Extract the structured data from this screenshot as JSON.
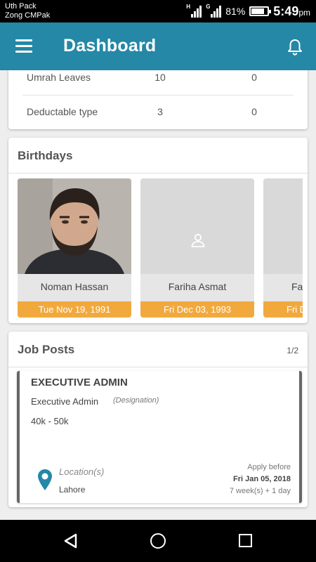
{
  "status_bar": {
    "carrier_line1": "Uth Pack",
    "carrier_line2": "Zong CMPak",
    "signal1_label": "H",
    "signal2_label": "G",
    "battery_percent": "81%",
    "battery_level": 0.81,
    "time": "5:49",
    "ampm": "pm"
  },
  "app_bar": {
    "title": "Dashboard",
    "menu_icon": "hamburger-menu-icon",
    "notification_icon": "bell-icon"
  },
  "leaves": {
    "rows": [
      {
        "type": "Umrah Leaves",
        "col2": "10",
        "col3": "0"
      },
      {
        "type": "Deductable type",
        "col2": "3",
        "col3": "0"
      }
    ]
  },
  "birthdays": {
    "title": "Birthdays",
    "items": [
      {
        "name": "Noman Hassan",
        "date": "Tue Nov 19, 1991",
        "has_photo": true
      },
      {
        "name": "Fariha Asmat",
        "date": "Fri Dec 03, 1993",
        "has_photo": false
      },
      {
        "name": "Fa",
        "date": "Fri D",
        "has_photo": false
      }
    ]
  },
  "job_posts": {
    "title": "Job Posts",
    "pager": "1/2",
    "job": {
      "title": "EXECUTIVE ADMIN",
      "designation": "Executive Admin",
      "designation_label": "(Designation)",
      "salary": "40k - 50k",
      "location_label": "Location(s)",
      "location": "Lahore",
      "apply_label": "Apply before",
      "apply_date": "Fri Jan 05, 2018",
      "apply_relative": "7 week(s) + 1 day"
    }
  },
  "colors": {
    "app_bar": "#2488a6",
    "birthday_date_bar": "#f1a93e",
    "location_pin": "#2488a6"
  }
}
